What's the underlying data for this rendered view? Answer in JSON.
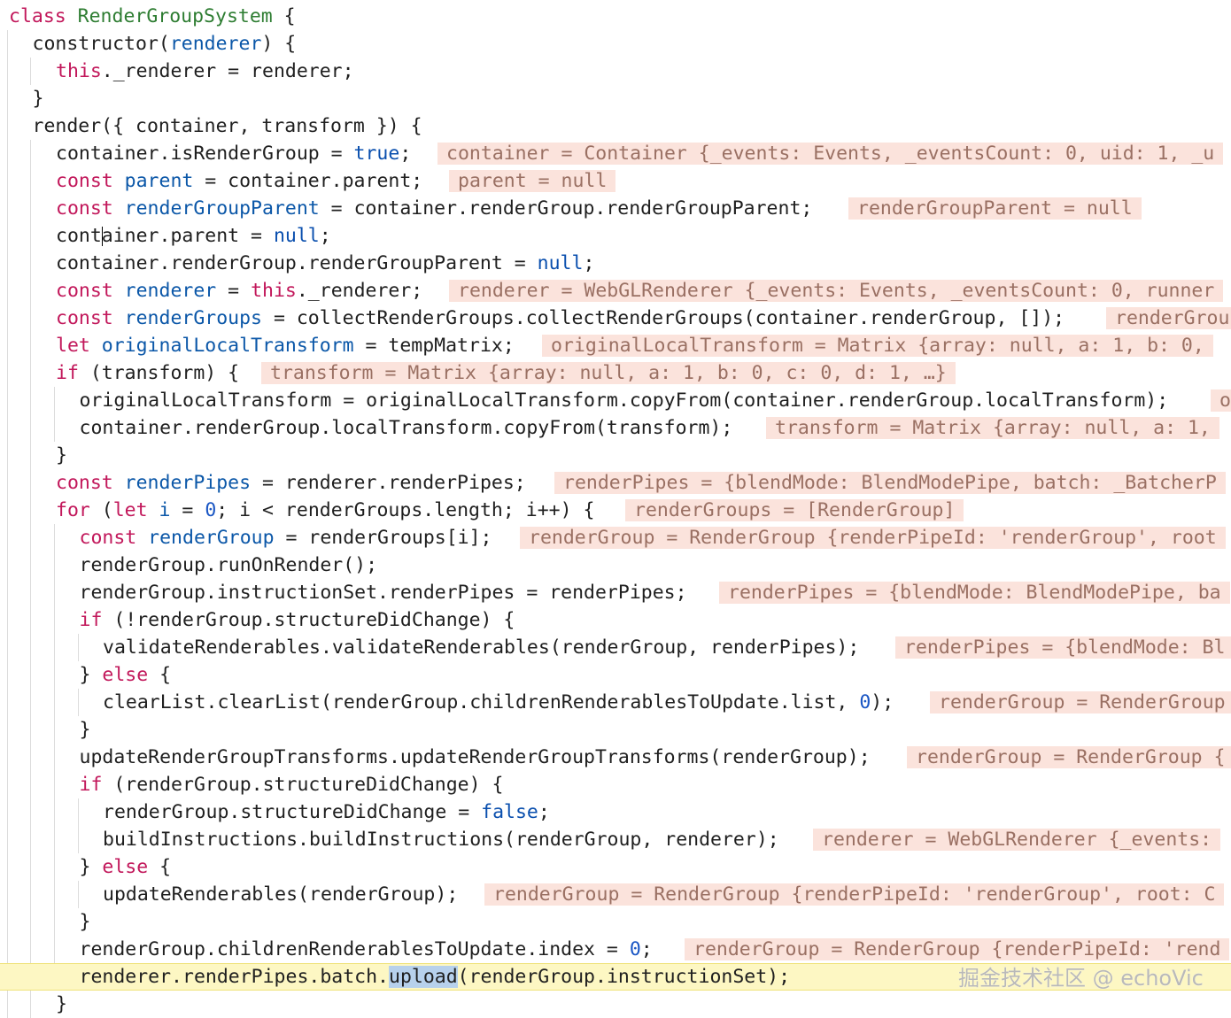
{
  "editor": {
    "lines": [
      {
        "indent": 0,
        "tokens": [
          {
            "t": "class ",
            "c": "kw"
          },
          {
            "t": "RenderGroupSystem",
            "c": "cls"
          },
          {
            "t": " {",
            "c": "plain"
          }
        ]
      },
      {
        "indent": 1,
        "tokens": [
          {
            "t": "constructor(",
            "c": "plain"
          },
          {
            "t": "renderer",
            "c": "var"
          },
          {
            "t": ") {",
            "c": "plain"
          }
        ]
      },
      {
        "indent": 2,
        "tokens": [
          {
            "t": "this",
            "c": "kw"
          },
          {
            "t": "._renderer = renderer;",
            "c": "plain"
          }
        ]
      },
      {
        "indent": 1,
        "tokens": [
          {
            "t": "}",
            "c": "plain"
          }
        ]
      },
      {
        "indent": 1,
        "tokens": [
          {
            "t": "render({ container, transform }) {",
            "c": "plain"
          }
        ]
      },
      {
        "indent": 2,
        "tokens": [
          {
            "t": "container.isRenderGroup = ",
            "c": "plain"
          },
          {
            "t": "true",
            "c": "lit"
          },
          {
            "t": ";",
            "c": "plain"
          }
        ],
        "hint": "container = Container {_events: Events, _eventsCount: 0, uid: 1, _u",
        "hintX": 494
      },
      {
        "indent": 2,
        "tokens": [
          {
            "t": "const ",
            "c": "kw"
          },
          {
            "t": "parent",
            "c": "var"
          },
          {
            "t": " = container.parent;",
            "c": "plain"
          }
        ],
        "hint": "parent = null",
        "hintX": 507
      },
      {
        "indent": 2,
        "tokens": [
          {
            "t": "const ",
            "c": "kw"
          },
          {
            "t": "renderGroupParent",
            "c": "var"
          },
          {
            "t": " = container.renderGroup.renderGroupParent;",
            "c": "plain"
          }
        ],
        "hint": "renderGroupParent = null",
        "hintX": 958
      },
      {
        "indent": 2,
        "tokens": [
          {
            "t": "cont",
            "c": "plain"
          },
          {
            "t": "",
            "c": "caret"
          },
          {
            "t": "ainer.parent = ",
            "c": "plain"
          },
          {
            "t": "null",
            "c": "lit"
          },
          {
            "t": ";",
            "c": "plain"
          }
        ]
      },
      {
        "indent": 2,
        "tokens": [
          {
            "t": "container.renderGroup.renderGroupParent = ",
            "c": "plain"
          },
          {
            "t": "null",
            "c": "lit"
          },
          {
            "t": ";",
            "c": "plain"
          }
        ]
      },
      {
        "indent": 2,
        "tokens": [
          {
            "t": "const ",
            "c": "kw"
          },
          {
            "t": "renderer",
            "c": "var"
          },
          {
            "t": " = ",
            "c": "plain"
          },
          {
            "t": "this",
            "c": "kw"
          },
          {
            "t": "._renderer;",
            "c": "plain"
          }
        ],
        "hint": "renderer = WebGLRenderer {_events: Events, _eventsCount: 0, runner",
        "hintX": 507
      },
      {
        "indent": 2,
        "tokens": [
          {
            "t": "const ",
            "c": "kw"
          },
          {
            "t": "renderGroups",
            "c": "var"
          },
          {
            "t": " = collectRenderGroups.collectRenderGroups(container.renderGroup, []);",
            "c": "plain"
          }
        ],
        "hint": "renderGrou",
        "hintX": 1249
      },
      {
        "indent": 2,
        "tokens": [
          {
            "t": "let ",
            "c": "kw"
          },
          {
            "t": "originalLocalTransform",
            "c": "var"
          },
          {
            "t": " = tempMatrix;",
            "c": "plain"
          }
        ],
        "hint": "originalLocalTransform = Matrix {array: null, a: 1, b: 0,",
        "hintX": 612
      },
      {
        "indent": 2,
        "tokens": [
          {
            "t": "if",
            "c": "kw"
          },
          {
            "t": " (transform) {",
            "c": "plain"
          }
        ],
        "hint": "transform = Matrix {array: null, a: 1, b: 0, c: 0, d: 1, …}",
        "hintX": 295
      },
      {
        "indent": 3,
        "tokens": [
          {
            "t": "originalLocalTransform = originalLocalTransform.copyFrom(container.renderGroup.localTransform);",
            "c": "plain"
          }
        ],
        "hint": "o",
        "hintX": 1367
      },
      {
        "indent": 3,
        "tokens": [
          {
            "t": "container.renderGroup.localTransform.copyFrom(transform);",
            "c": "plain"
          }
        ],
        "hint": "transform = Matrix {array: null, a: 1,",
        "hintX": 865
      },
      {
        "indent": 2,
        "tokens": [
          {
            "t": "}",
            "c": "plain"
          }
        ]
      },
      {
        "indent": 2,
        "tokens": [
          {
            "t": "const ",
            "c": "kw"
          },
          {
            "t": "renderPipes",
            "c": "var"
          },
          {
            "t": " = renderer.renderPipes;",
            "c": "plain"
          }
        ],
        "hint": "renderPipes = {blendMode: BlendModePipe, batch: _BatcherP",
        "hintX": 626
      },
      {
        "indent": 2,
        "tokens": [
          {
            "t": "for",
            "c": "kw"
          },
          {
            "t": " (",
            "c": "plain"
          },
          {
            "t": "let ",
            "c": "kw"
          },
          {
            "t": "i",
            "c": "var"
          },
          {
            "t": " = ",
            "c": "plain"
          },
          {
            "t": "0",
            "c": "num"
          },
          {
            "t": "; i < renderGroups.length; i++) {",
            "c": "plain"
          }
        ],
        "hint": "renderGroups = [RenderGroup]",
        "hintX": 706
      },
      {
        "indent": 3,
        "tokens": [
          {
            "t": "const ",
            "c": "kw"
          },
          {
            "t": "renderGroup",
            "c": "var"
          },
          {
            "t": " = renderGroups[i];",
            "c": "plain"
          }
        ],
        "hint": "renderGroup = RenderGroup {renderPipeId: 'renderGroup', root",
        "hintX": 587
      },
      {
        "indent": 3,
        "tokens": [
          {
            "t": "renderGroup.runOnRender();",
            "c": "plain"
          }
        ]
      },
      {
        "indent": 3,
        "tokens": [
          {
            "t": "renderGroup.instructionSet.renderPipes = renderPipes;",
            "c": "plain"
          }
        ],
        "hint": "renderPipes = {blendMode: BlendModePipe, ba",
        "hintX": 812
      },
      {
        "indent": 3,
        "tokens": [
          {
            "t": "if",
            "c": "kw"
          },
          {
            "t": " (!renderGroup.structureDidChange) {",
            "c": "plain"
          }
        ]
      },
      {
        "indent": 4,
        "tokens": [
          {
            "t": "validateRenderables.validateRenderables(renderGroup, renderPipes);",
            "c": "plain"
          }
        ],
        "hint": "renderPipes = {blendMode: Bl",
        "hintX": 1011
      },
      {
        "indent": 3,
        "tokens": [
          {
            "t": "} ",
            "c": "plain"
          },
          {
            "t": "else",
            "c": "kw"
          },
          {
            "t": " {",
            "c": "plain"
          }
        ]
      },
      {
        "indent": 4,
        "tokens": [
          {
            "t": "clearList.clearList(renderGroup.childrenRenderablesToUpdate.list, ",
            "c": "plain"
          },
          {
            "t": "0",
            "c": "num"
          },
          {
            "t": ");",
            "c": "plain"
          }
        ],
        "hint": "renderGroup = RenderGroup",
        "hintX": 1050
      },
      {
        "indent": 3,
        "tokens": [
          {
            "t": "}",
            "c": "plain"
          }
        ]
      },
      {
        "indent": 3,
        "tokens": [
          {
            "t": "updateRenderGroupTransforms.updateRenderGroupTransforms(renderGroup);",
            "c": "plain"
          }
        ],
        "hint": "renderGroup = RenderGroup {",
        "hintX": 1024
      },
      {
        "indent": 3,
        "tokens": [
          {
            "t": "if",
            "c": "kw"
          },
          {
            "t": " (renderGroup.structureDidChange) {",
            "c": "plain"
          }
        ]
      },
      {
        "indent": 4,
        "tokens": [
          {
            "t": "renderGroup.structureDidChange = ",
            "c": "plain"
          },
          {
            "t": "false",
            "c": "lit"
          },
          {
            "t": ";",
            "c": "plain"
          }
        ]
      },
      {
        "indent": 4,
        "tokens": [
          {
            "t": "buildInstructions.buildInstructions(renderGroup, renderer);",
            "c": "plain"
          }
        ],
        "hint": "renderer = WebGLRenderer {_events:",
        "hintX": 918
      },
      {
        "indent": 3,
        "tokens": [
          {
            "t": "} ",
            "c": "plain"
          },
          {
            "t": "else",
            "c": "kw"
          },
          {
            "t": " {",
            "c": "plain"
          }
        ]
      },
      {
        "indent": 4,
        "tokens": [
          {
            "t": "updateRenderables(renderGroup);",
            "c": "plain"
          }
        ],
        "hint": "renderGroup = RenderGroup {renderPipeId: 'renderGroup', root: C",
        "hintX": 547
      },
      {
        "indent": 3,
        "tokens": [
          {
            "t": "}",
            "c": "plain"
          }
        ]
      },
      {
        "indent": 3,
        "tokens": [
          {
            "t": "renderGroup.childrenRenderablesToUpdate.index = ",
            "c": "plain"
          },
          {
            "t": "0",
            "c": "num"
          },
          {
            "t": ";",
            "c": "plain"
          }
        ],
        "hint": "renderGroup = RenderGroup {renderPipeId: 'rend",
        "hintX": 773
      },
      {
        "indent": 3,
        "highlight": true,
        "tokens": [
          {
            "t": "renderer.renderPipes.batch.",
            "c": "plain"
          },
          {
            "t": "upload",
            "c": "sel"
          },
          {
            "t": "(renderGroup.instructionSet);",
            "c": "plain"
          }
        ]
      },
      {
        "indent": 2,
        "tokens": [
          {
            "t": "}",
            "c": "plain"
          }
        ]
      }
    ]
  },
  "watermark": "掘金技术社区 @ echoVic"
}
